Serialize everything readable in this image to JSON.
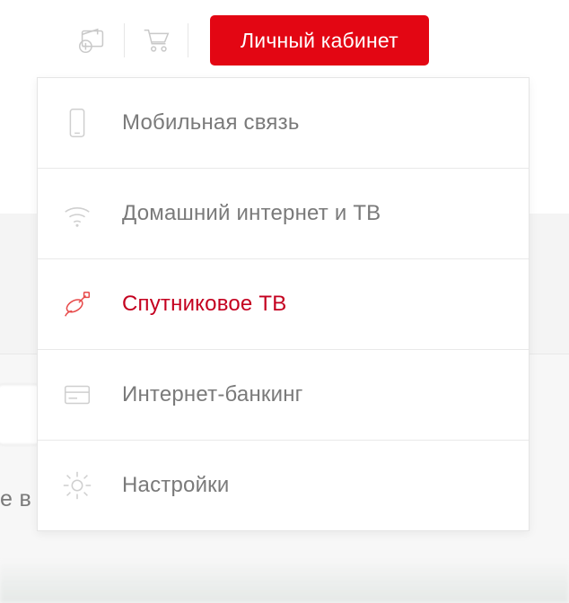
{
  "toolbar": {
    "account_button_label": "Личный кабинет"
  },
  "background": {
    "cut_off_text": "е в"
  },
  "menu": {
    "items": [
      {
        "label": "Мобильная связь",
        "icon": "mobile-icon",
        "active": false
      },
      {
        "label": "Домашний интернет и ТВ",
        "icon": "wifi-icon",
        "active": false
      },
      {
        "label": "Спутниковое ТВ",
        "icon": "satellite-icon",
        "active": true
      },
      {
        "label": "Интернет-банкинг",
        "icon": "card-icon",
        "active": false
      },
      {
        "label": "Настройки",
        "icon": "gear-icon",
        "active": false
      }
    ]
  },
  "colors": {
    "accent": "#e30613",
    "accent_text": "#c4001f",
    "muted_text": "#7a7a7a",
    "icon_grey": "#cfcfcf",
    "divider": "#e9e9e9"
  }
}
